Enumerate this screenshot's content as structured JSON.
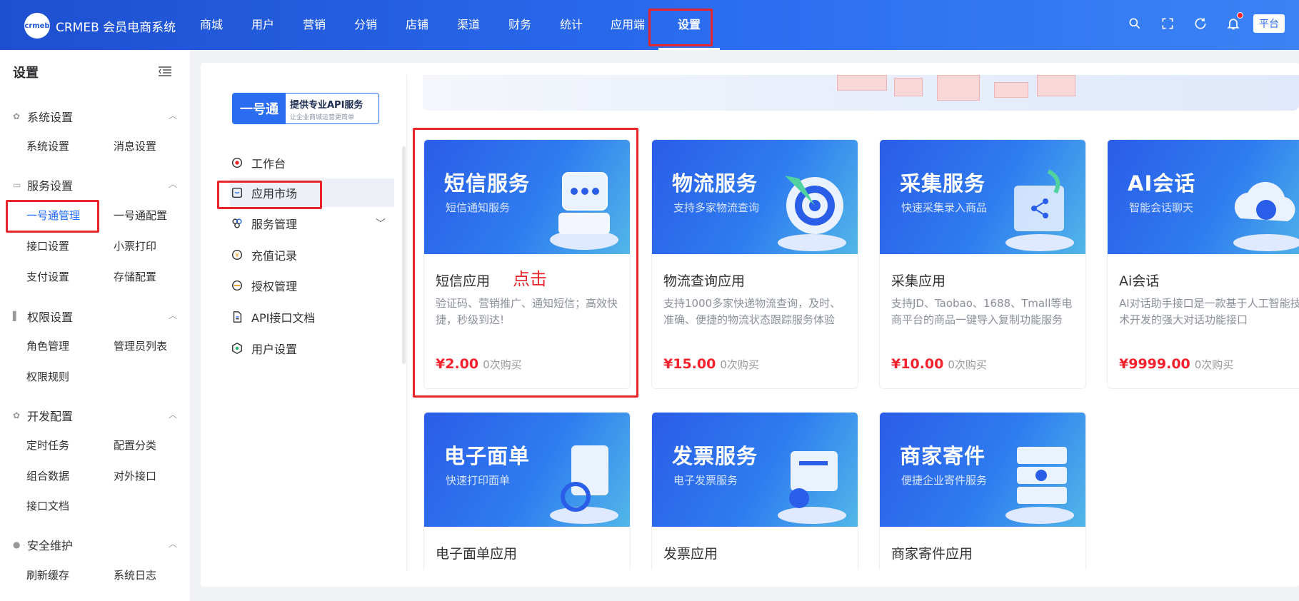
{
  "app": {
    "logo_badge": "crmeb",
    "title": "CRMEB 会员电商系统"
  },
  "nav": {
    "items": [
      "商城",
      "用户",
      "营销",
      "分销",
      "店铺",
      "渠道",
      "财务",
      "统计",
      "应用端",
      "设置"
    ],
    "platform_label": "平台"
  },
  "sidebar": {
    "title": "设置",
    "groups": [
      {
        "label": "系统设置",
        "items": [
          "系统设置",
          "消息设置"
        ]
      },
      {
        "label": "服务设置",
        "items": [
          "一号通管理",
          "一号通配置",
          "接口设置",
          "小票打印",
          "支付设置",
          "存储配置"
        ]
      },
      {
        "label": "权限设置",
        "items": [
          "角色管理",
          "管理员列表",
          "权限规则"
        ]
      },
      {
        "label": "开发配置",
        "items": [
          "定时任务",
          "配置分类",
          "组合数据",
          "对外接口",
          "接口文档"
        ]
      },
      {
        "label": "安全维护",
        "items": [
          "刷新缓存",
          "系统日志"
        ]
      }
    ]
  },
  "yht": {
    "name": "一号通",
    "slogan": "提供专业API服务",
    "sub": "让企业商城运营更简单"
  },
  "subnav": [
    "工作台",
    "应用市场",
    "服务管理",
    "充值记录",
    "授权管理",
    "API接口文档",
    "用户设置"
  ],
  "click_hint": "点击",
  "cards": [
    {
      "img_title": "短信服务",
      "img_sub": "短信通知服务",
      "name": "短信应用",
      "desc": "验证码、营销推广、通知短信；高效快捷，秒级到达!",
      "price": "¥2.00",
      "bought": "0次购买"
    },
    {
      "img_title": "物流服务",
      "img_sub": "支持多家物流查询",
      "name": "物流查询应用",
      "desc": "支持1000多家快递物流查询，及时、准确、便捷的物流状态跟踪服务体验",
      "price": "¥15.00",
      "bought": "0次购买"
    },
    {
      "img_title": "采集服务",
      "img_sub": "快速采集录入商品",
      "name": "采集应用",
      "desc": "支持JD、Taobao、1688、Tmall等电商平台的商品一键导入复制功能服务",
      "price": "¥10.00",
      "bought": "0次购买"
    },
    {
      "img_title": "AI会话",
      "img_sub": "智能会话聊天",
      "name": "Ai会话",
      "desc": "AI对话助手接口是一款基于人工智能技术开发的强大对话功能接口",
      "price": "¥9999.00",
      "bought": "0次购买"
    },
    {
      "img_title": "电子面单",
      "img_sub": "快速打印面单",
      "name": "电子面单应用"
    },
    {
      "img_title": "发票服务",
      "img_sub": "电子发票服务",
      "name": "发票应用"
    },
    {
      "img_title": "商家寄件",
      "img_sub": "便捷企业寄件服务",
      "name": "商家寄件应用"
    }
  ],
  "colors": {
    "primary": "#2a6df0",
    "highlight": "#e8252a",
    "price": "#f5222d",
    "active_text": "#1f6bff"
  }
}
